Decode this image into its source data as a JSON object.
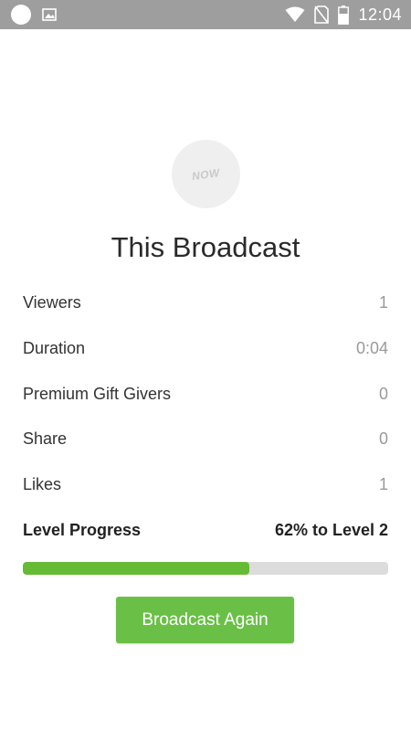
{
  "status_bar": {
    "time": "12:04",
    "icons": [
      "circle-notification-icon",
      "image-notification-icon",
      "wifi-icon",
      "no-sim-icon",
      "battery-icon"
    ]
  },
  "avatar": {
    "text": "NOW"
  },
  "title": "This Broadcast",
  "stats": [
    {
      "label": "Viewers",
      "value": "1"
    },
    {
      "label": "Duration",
      "value": "0:04"
    },
    {
      "label": "Premium Gift Givers",
      "value": "0"
    },
    {
      "label": "Share",
      "value": "0"
    },
    {
      "label": "Likes",
      "value": "1"
    }
  ],
  "level": {
    "label": "Level Progress",
    "value": "62% to Level 2",
    "progress_fraction": 0.62
  },
  "button": {
    "label": "Broadcast Again"
  },
  "colors": {
    "accent_green": "#6ac046",
    "progress_green": "#66bb34",
    "status_bar": "#9e9e9e"
  }
}
